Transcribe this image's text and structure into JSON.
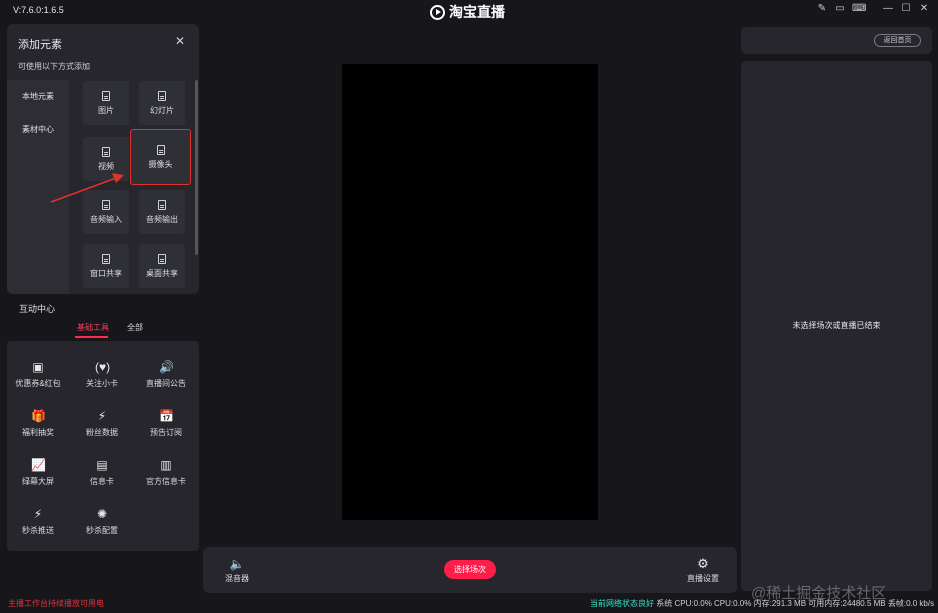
{
  "app": {
    "version": "V:7.6.0:1.6.5",
    "brand": "淘宝直播"
  },
  "add_panel": {
    "title": "添加元素",
    "subtitle": "可使用以下方式添加",
    "categories": [
      "本地元素",
      "素材中心"
    ],
    "tiles": [
      "图片",
      "幻灯片",
      "视频",
      "摄像头",
      "音频输入",
      "音频输出",
      "窗口共享",
      "桌面共享"
    ],
    "selected_tile": "摄像头"
  },
  "interactive": {
    "title": "互动中心",
    "tabs": [
      "基础工具",
      "全部"
    ],
    "active_tab": "基础工具",
    "tools": [
      "优惠券&红包",
      "关注小卡",
      "直播间公告",
      "福利抽奖",
      "粉丝数据",
      "预告订阅",
      "绿幕大屏",
      "信息卡",
      "官方信息卡",
      "秒杀推送",
      "秒杀配置"
    ]
  },
  "bottom": {
    "mic_label": "混音器",
    "select_button": "选择场次",
    "setting_label": "直播设置"
  },
  "right": {
    "return_button": "返回首页",
    "empty_text": "未选择场次或直播已结束"
  },
  "footer": {
    "warning": "主播工作台持续播放可用电",
    "status_ok": "当前网络状态良好",
    "status_stats": "系统 CPU:0.0% CPU:0.0% 内存:291.3 MB 可用内存:24480.5 MB 丢帧:0.0 kb/s"
  },
  "watermark": "@稀土掘金技术社区",
  "colors": {
    "accent": "#ff1e4a",
    "selection_border": "#e0312f",
    "status_ok": "#36e3c8",
    "background": "#17171b",
    "panel": "#26262c"
  }
}
